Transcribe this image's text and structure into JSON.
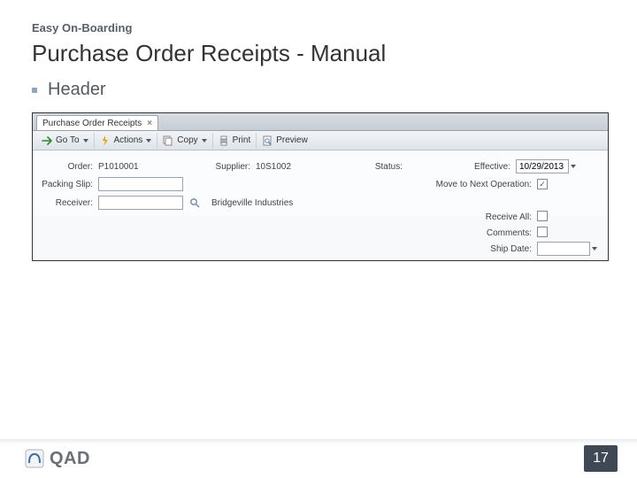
{
  "slide": {
    "kicker": "Easy On-Boarding",
    "title": "Purchase Order Receipts - Manual",
    "bullet": "Header"
  },
  "app": {
    "tab": {
      "title": "Purchase Order Receipts"
    },
    "toolbar": {
      "goto": "Go To",
      "actions": "Actions",
      "copy": "Copy",
      "print": "Print",
      "preview": "Preview"
    },
    "form": {
      "order_label": "Order:",
      "order_value": "P1010001",
      "supplier_label": "Supplier:",
      "supplier_value": "10S1002",
      "status_label": "Status:",
      "effective_label": "Effective:",
      "effective_value": "10/29/2013",
      "packing_label": "Packing Slip:",
      "packing_value": "",
      "movenext_label": "Move to Next Operation:",
      "movenext_checked": true,
      "receiver_label": "Receiver:",
      "receiver_value": "",
      "receiver_desc": "Bridgeville Industries",
      "receiveall_label": "Receive All:",
      "receiveall_checked": false,
      "comments_label": "Comments:",
      "comments_checked": false,
      "shipdate_label": "Ship Date:",
      "shipdate_value": ""
    }
  },
  "footer": {
    "brand": "QAD",
    "page": "17"
  }
}
